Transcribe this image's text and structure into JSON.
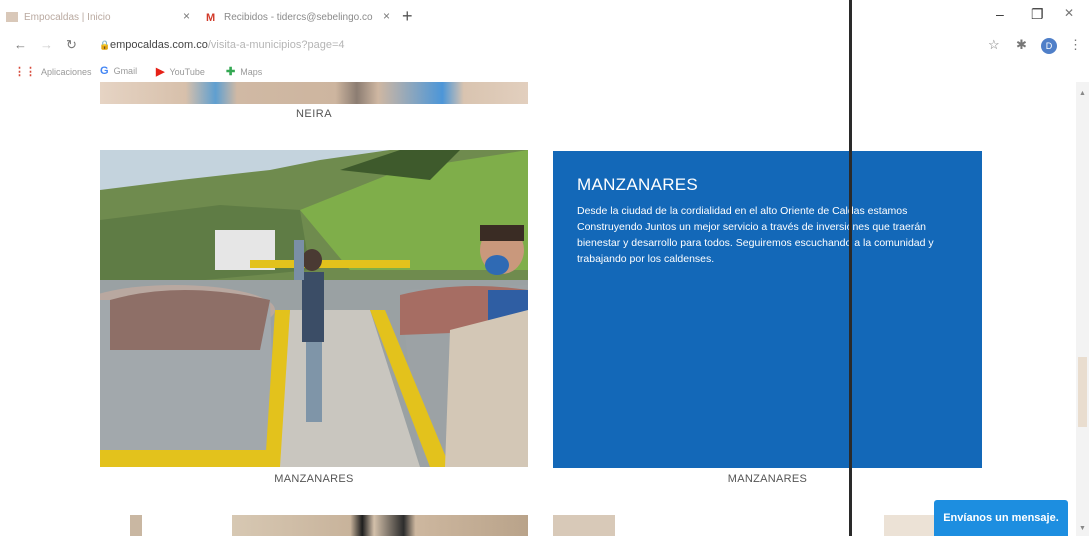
{
  "browser": {
    "tabs": [
      {
        "title": "Empocaldas | Inicio",
        "close": "×"
      },
      {
        "title": "Recibidos - tidercs@sebelingo.co",
        "close": "×"
      }
    ],
    "new_tab": "+",
    "window_controls": {
      "minimize": "–",
      "restore": "❐",
      "close": "✕"
    },
    "url": {
      "domain": "empocaldas.com.co",
      "path": "/visita-a-municipios?page=4"
    },
    "bookmarks": [
      {
        "icon": "apps-grid-icon",
        "label": "Aplicaciones"
      },
      {
        "icon": "google-icon",
        "label": "Gmail"
      },
      {
        "icon": "youtube-icon",
        "label": "YouTube"
      },
      {
        "icon": "maps-icon",
        "label": "Maps"
      }
    ],
    "profile_initial": "D"
  },
  "gallery": {
    "prev_label": "NEIRA",
    "photo_label": "MANZANARES",
    "card": {
      "title": "MANZANARES",
      "text": "Desde la ciudad de la cordialidad en el alto Oriente de Caldas estamos Construyendo Juntos un mejor servicio a través de inversiones que traerán bienestar y desarrollo para todos. Seguiremos escuchando a la comunidad y trabajando por los caldenses.",
      "label": "MANZANARES"
    }
  },
  "chat": {
    "label": "Envíanos un mensaje."
  },
  "colors": {
    "card_bg": "#1368b8",
    "chat_bg": "#1d8ee0"
  }
}
